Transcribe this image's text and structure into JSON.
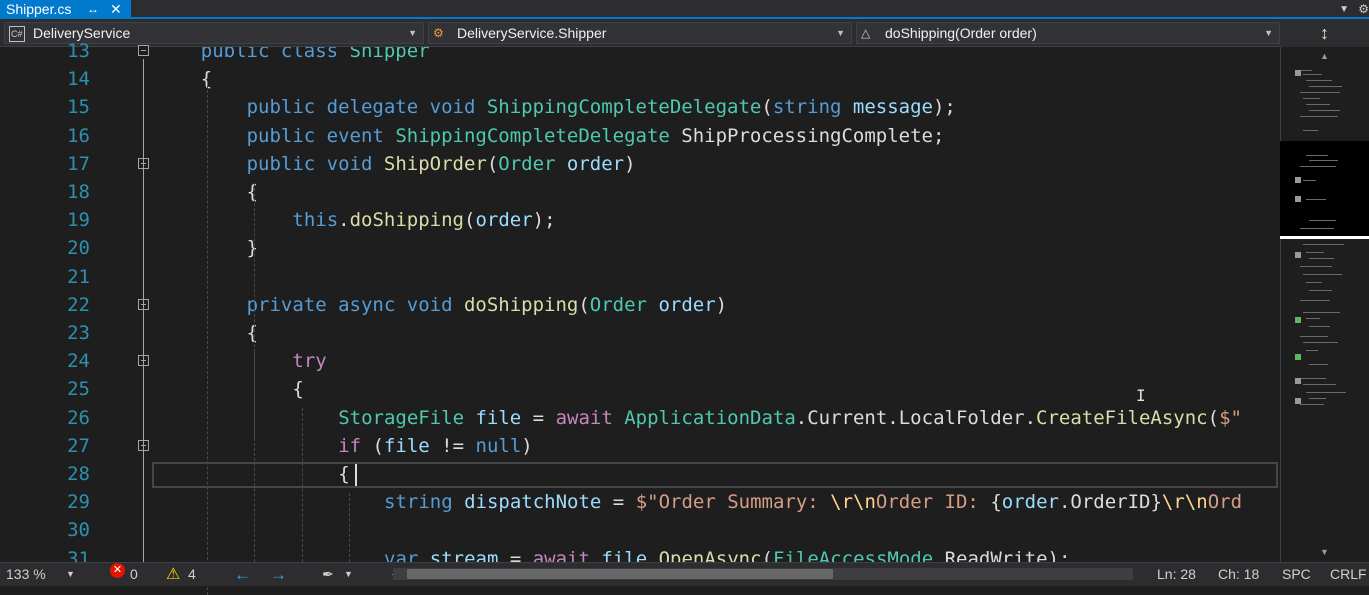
{
  "tab": {
    "title": "Shipper.cs",
    "pin_glyph": "↔",
    "close_glyph": "✕"
  },
  "tabstrip": {
    "dropdown_glyph": "▼",
    "gear_glyph": "⚙"
  },
  "nav": {
    "project": {
      "icon": "C#",
      "label": "DeliveryService"
    },
    "type": {
      "label": "DeliveryService.Shipper"
    },
    "member": {
      "label": "doShipping(Order order)"
    },
    "arrow": "▼"
  },
  "splitter_glyph": "↕",
  "line_numbers": [
    "13",
    "14",
    "15",
    "16",
    "17",
    "18",
    "19",
    "20",
    "21",
    "22",
    "23",
    "24",
    "25",
    "26",
    "27",
    "28",
    "29",
    "30",
    "31"
  ],
  "code_lines": [
    [
      [
        "kw",
        "public "
      ],
      [
        "kw",
        "class "
      ],
      [
        "ty",
        "Shipper"
      ]
    ],
    [
      [
        "pl",
        "{"
      ]
    ],
    [
      [
        "kw",
        "public "
      ],
      [
        "kw",
        "delegate "
      ],
      [
        "kw",
        "void "
      ],
      [
        "ty",
        "ShippingCompleteDelegate"
      ],
      [
        "pl",
        "("
      ],
      [
        "kw",
        "string "
      ],
      [
        "pa",
        "message"
      ],
      [
        "pl",
        ");"
      ]
    ],
    [
      [
        "kw",
        "public "
      ],
      [
        "kw",
        "event "
      ],
      [
        "ty",
        "ShippingCompleteDelegate "
      ],
      [
        "pl",
        "ShipProcessingComplete;"
      ]
    ],
    [
      [
        "kw",
        "public "
      ],
      [
        "kw",
        "void "
      ],
      [
        "fn",
        "ShipOrder"
      ],
      [
        "pl",
        "("
      ],
      [
        "ty",
        "Order "
      ],
      [
        "pa",
        "order"
      ],
      [
        "pl",
        ")"
      ]
    ],
    [
      [
        "pl",
        "{"
      ]
    ],
    [
      [
        "kw",
        "this"
      ],
      [
        "pl",
        "."
      ],
      [
        "fn",
        "doShipping"
      ],
      [
        "pl",
        "("
      ],
      [
        "pa",
        "order"
      ],
      [
        "pl",
        ");"
      ]
    ],
    [
      [
        "pl",
        "}"
      ]
    ],
    [],
    [
      [
        "kw",
        "private "
      ],
      [
        "kw",
        "async "
      ],
      [
        "kw",
        "void "
      ],
      [
        "fn",
        "doShipping"
      ],
      [
        "pl",
        "("
      ],
      [
        "ty",
        "Order "
      ],
      [
        "pa",
        "order"
      ],
      [
        "pl",
        ")"
      ]
    ],
    [
      [
        "pl",
        "{"
      ]
    ],
    [
      [
        "kw2",
        "try"
      ]
    ],
    [
      [
        "pl",
        "{"
      ]
    ],
    [
      [
        "ty",
        "StorageFile "
      ],
      [
        "pa",
        "file "
      ],
      [
        "pl",
        "= "
      ],
      [
        "kw2",
        "await "
      ],
      [
        "ty",
        "ApplicationData"
      ],
      [
        "pl",
        ".Current.LocalFolder."
      ],
      [
        "fn",
        "CreateFileAsync"
      ],
      [
        "pl",
        "("
      ],
      [
        "st",
        "$\""
      ]
    ],
    [
      [
        "kw2",
        "if "
      ],
      [
        "pl",
        "("
      ],
      [
        "pa",
        "file "
      ],
      [
        "pl",
        "!= "
      ],
      [
        "kw",
        "null"
      ],
      [
        "pl",
        ")"
      ]
    ],
    [
      [
        "pl",
        "{"
      ]
    ],
    [
      [
        "kw",
        "string "
      ],
      [
        "pa",
        "dispatchNote "
      ],
      [
        "pl",
        "= "
      ],
      [
        "st",
        "$\"Order Summary: "
      ],
      [
        "esc",
        "\\r\\n"
      ],
      [
        "st",
        "Order ID: "
      ],
      [
        "pl",
        "{"
      ],
      [
        "pa",
        "order"
      ],
      [
        "pl",
        ".OrderID}"
      ],
      [
        "esc",
        "\\r\\n"
      ],
      [
        "st",
        "Ord"
      ]
    ],
    [],
    [
      [
        "kw",
        "var "
      ],
      [
        "pa",
        "stream "
      ],
      [
        "pl",
        "= "
      ],
      [
        "kw2",
        "await "
      ],
      [
        "pa",
        "file"
      ],
      [
        "pl",
        "."
      ],
      [
        "fn",
        "OpenAsync"
      ],
      [
        "pl",
        "("
      ],
      [
        "ty",
        "FileAccessMode"
      ],
      [
        "pl",
        ".ReadWrite);"
      ]
    ]
  ],
  "status": {
    "zoom": "133 %",
    "errors": "0",
    "error_glyph": "✕",
    "warnings": "4",
    "warning_glyph": "⚠",
    "nav_back": "←",
    "nav_forward": "→",
    "brush_glyph": "✒",
    "scroll_left": "◀",
    "scroll_right": "▶",
    "line": "Ln: 28",
    "col": "Ch: 18",
    "spacing": "SPC",
    "eol": "CRLF"
  },
  "colors": {
    "accent": "#007acc",
    "keyword": "#569cd6",
    "control": "#c586c0",
    "type": "#4ec9b0",
    "method": "#dcdcaa",
    "param": "#9cdcfe",
    "string": "#d69d85",
    "line_number": "#2b91af"
  }
}
